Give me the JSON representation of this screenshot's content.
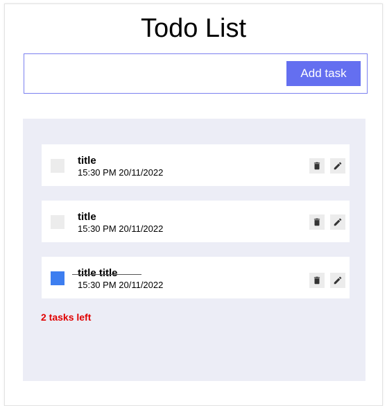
{
  "app": {
    "title": "Todo List"
  },
  "input": {
    "value": "",
    "add_label": "Add task"
  },
  "tasks": [
    {
      "title": "title",
      "time": "15:30 PM 20/11/2022",
      "completed": false
    },
    {
      "title": "title",
      "time": "15:30 PM 20/11/2022",
      "completed": false
    },
    {
      "title": "title title",
      "time": "15:30 PM 20/11/2022",
      "completed": true
    }
  ],
  "footer": {
    "tasks_left": "2 tasks left"
  },
  "icons": {
    "delete": "trash-icon",
    "edit": "pencil-icon"
  },
  "colors": {
    "accent": "#646ff0",
    "checked": "#3d7ef0",
    "panel": "#ecedf6",
    "warning": "#e00000"
  }
}
